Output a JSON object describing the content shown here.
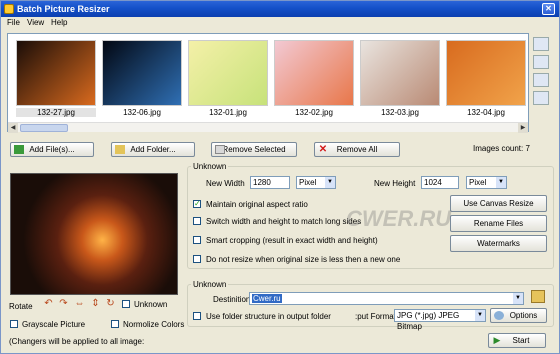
{
  "window": {
    "title": "Batch Picture Resizer"
  },
  "menu": [
    "File",
    "View",
    "Help"
  ],
  "thumbnails": [
    {
      "name": "132-27.jpg",
      "selected": true,
      "colors": [
        "#1a0d08",
        "#d96a1e"
      ]
    },
    {
      "name": "132-06.jpg",
      "selected": false,
      "colors": [
        "#020712",
        "#2f6fb4"
      ]
    },
    {
      "name": "132-01.jpg",
      "selected": false,
      "colors": [
        "#f4f0a8",
        "#c7e27a"
      ]
    },
    {
      "name": "132-02.jpg",
      "selected": false,
      "colors": [
        "#f2c9d3",
        "#e8774a"
      ]
    },
    {
      "name": "132-03.jpg",
      "selected": false,
      "colors": [
        "#e9e4df",
        "#b98a74"
      ]
    },
    {
      "name": "132-04.jpg",
      "selected": false,
      "colors": [
        "#d86b1f",
        "#f1a34a"
      ]
    }
  ],
  "buttons": {
    "add_files": "Add File(s)...",
    "add_folder": "Add Folder...",
    "remove_selected": "Remove Selected",
    "remove_all": "Remove All"
  },
  "images_count": "Images count: 7",
  "resize": {
    "group": "Unknown",
    "new_width_label": "New Width",
    "new_width": "1280",
    "width_unit": "Pixel",
    "new_height_label": "New Height",
    "new_height": "1024",
    "height_unit": "Pixel",
    "maintain": "Maintain original aspect ratio",
    "switch": "Switch width and height to match long sides",
    "smart": "Smart cropping (result in exact width and height)",
    "noresize": "Do not resize when original size is less then a new one"
  },
  "side_buttons": {
    "canvas": "Use Canvas Resize",
    "rename": "Rename Files",
    "watermarks": "Watermarks"
  },
  "preview": {
    "rotate_label": "Rotate",
    "unknown": "Unknown",
    "grayscale": "Grayscale Picture",
    "normalize": "Normolize Colors",
    "footnote": "(Changers will be applied to all image:"
  },
  "output": {
    "group": "Unknown",
    "dest_label": "Destinition",
    "dest_value": "Cwer.ru",
    "folder_structure": "Use folder structure in output folder",
    "format_label": ":put Format",
    "format_value": "JPG (*.jpg) JPEG Bitmap",
    "options": "Options"
  },
  "start": "Start",
  "watermark_text": "CWER.RU"
}
